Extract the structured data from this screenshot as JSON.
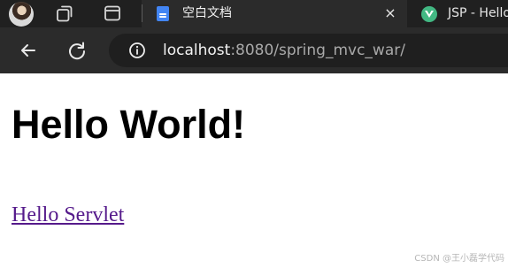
{
  "browser": {
    "tabs": [
      {
        "title": "空白文档",
        "favicon": "document-icon",
        "active": true
      },
      {
        "title": "JSP - Hello",
        "favicon": "vue-icon",
        "active": false
      }
    ],
    "address_bar": {
      "host": "localhost",
      "rest": ":8080/spring_mvc_war/"
    },
    "icons": {
      "profile": "avatar-icon",
      "workspaces": "workspaces-icon",
      "tab_actions": "tab-actions-icon",
      "close": "close-icon",
      "back": "back-arrow-icon",
      "reload": "reload-icon",
      "site_info": "site-info-icon"
    }
  },
  "page": {
    "heading": "Hello World!",
    "link_text": "Hello Servlet"
  },
  "overlay": {
    "watermark": "CSDN @王小磊学代码"
  },
  "colors": {
    "tabstrip": "#202020",
    "toolbar": "#2b2b2b",
    "omnibox": "#1f1f1f",
    "visited_link": "#551a8b",
    "docs_blue": "#4285f4",
    "vue_green": "#42b883"
  }
}
